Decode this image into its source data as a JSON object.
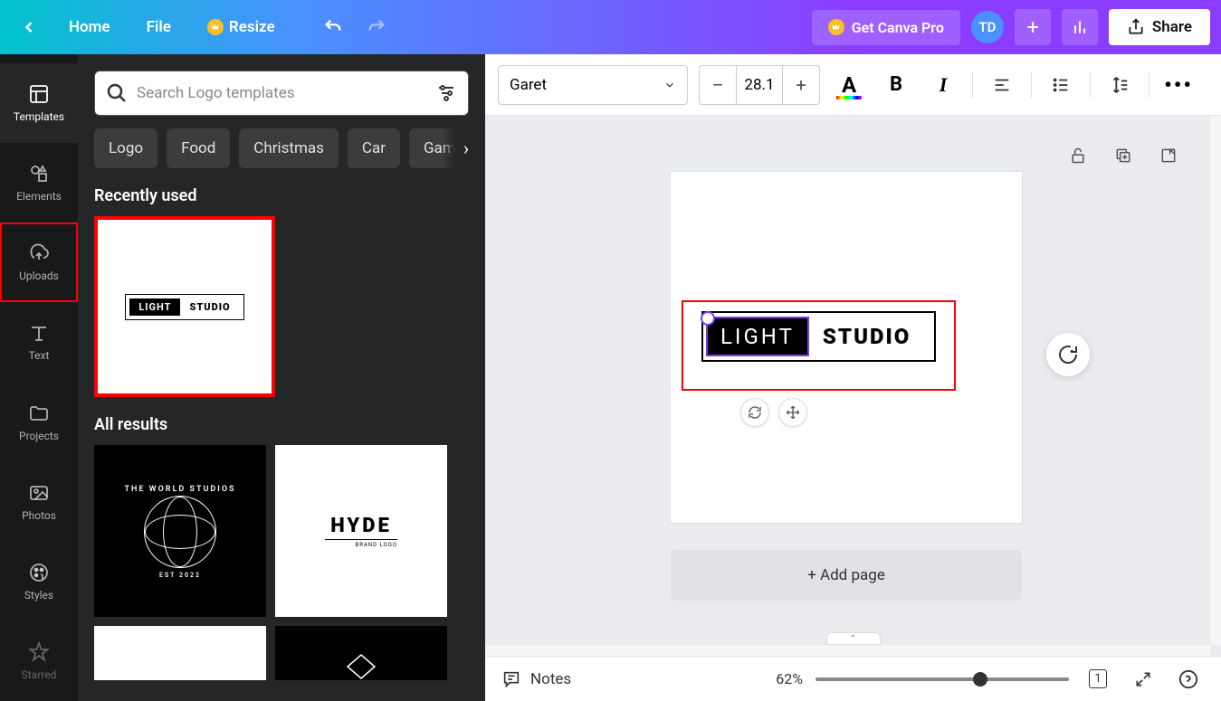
{
  "nav": {
    "home": "Home",
    "file": "File",
    "resize": "Resize",
    "pro": "Get Canva Pro",
    "avatar": "TD",
    "share": "Share"
  },
  "rail": {
    "templates": "Templates",
    "elements": "Elements",
    "uploads": "Uploads",
    "text": "Text",
    "projects": "Projects",
    "photos": "Photos",
    "styles": "Styles",
    "starred": "Starred"
  },
  "panel": {
    "search_placeholder": "Search Logo templates",
    "chips": {
      "logo": "Logo",
      "food": "Food",
      "christmas": "Christmas",
      "car": "Car",
      "gaming": "Gamin"
    },
    "recently_used": "Recently used",
    "all_results": "All results",
    "recent": {
      "light": "LIGHT",
      "studio": "STUDIO"
    },
    "result1": {
      "top": "THE WORLD STUDIOS",
      "bottom": "EST 2022"
    },
    "result2": {
      "main": "HYDE",
      "sub": "BRAND LOGO"
    }
  },
  "toolbar": {
    "font": "Garet",
    "size": "28.1",
    "color_label": "A",
    "bold": "B",
    "italic": "I"
  },
  "design": {
    "light": "LIGHT",
    "studio": "STUDIO"
  },
  "workspace": {
    "add_page": "+ Add page"
  },
  "footer": {
    "notes": "Notes",
    "zoom": "62%",
    "page_count": "1"
  }
}
